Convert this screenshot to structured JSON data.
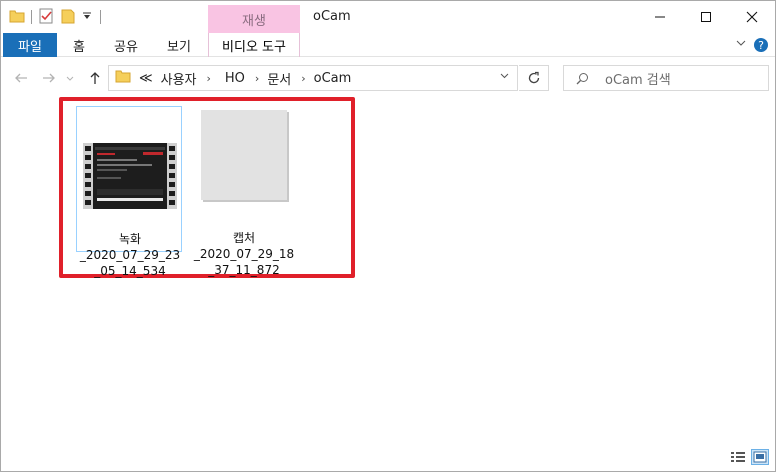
{
  "window": {
    "title": "oCam",
    "context_tab": "재생",
    "accent": "#1a6fb8",
    "highlight_color": "#e0202a"
  },
  "qat": {
    "icons": [
      "folder-icon",
      "properties-icon",
      "new-folder-icon",
      "customize-dropdown-icon"
    ]
  },
  "ribbon": {
    "tabs": [
      {
        "label": "파일"
      },
      {
        "label": "홈"
      },
      {
        "label": "공유"
      },
      {
        "label": "보기"
      },
      {
        "label": "비디오 도구"
      }
    ]
  },
  "address": {
    "prefix": "≪",
    "crumbs": [
      "사용자",
      "HO",
      "문서",
      "oCam"
    ]
  },
  "search": {
    "placeholder": "oCam 검색"
  },
  "files": [
    {
      "name": "녹화\n_2020_07_29_23\n_05_14_534",
      "type": "video",
      "selected": true
    },
    {
      "name": "캡처\n_2020_07_29_18\n_37_11_872",
      "type": "image",
      "selected": false
    }
  ]
}
